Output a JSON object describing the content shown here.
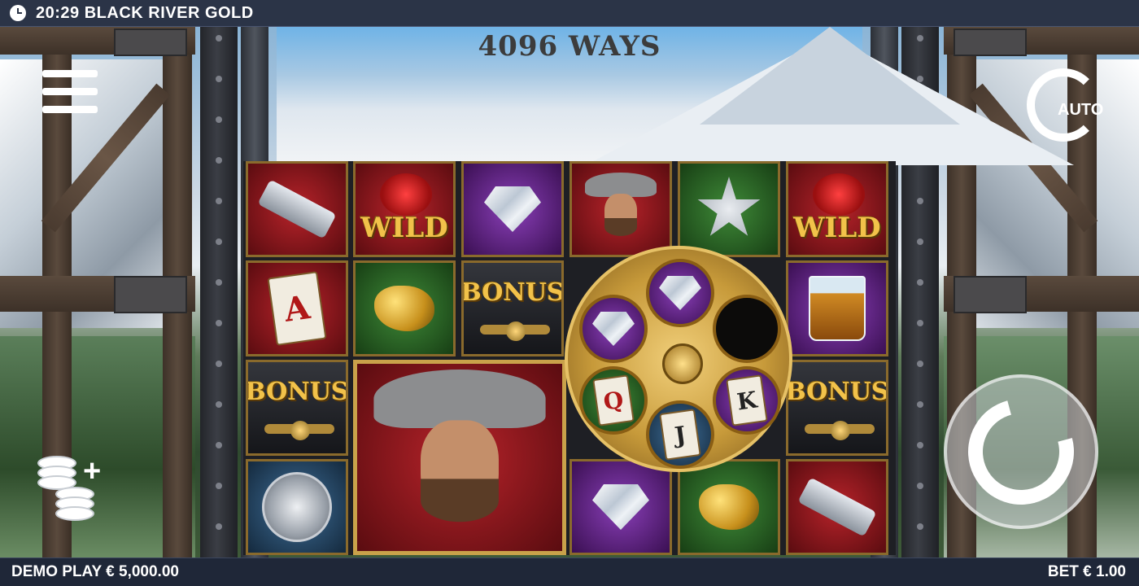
{
  "top_bar": {
    "time": "20:29",
    "title": "BLACK RIVER GOLD"
  },
  "banner": {
    "ways": "4096 WAYS"
  },
  "buttons": {
    "auto_label": "AUTO"
  },
  "reels": {
    "symbols": {
      "wild": "WILD",
      "bonus": "BONUS",
      "card_a": "A",
      "card_q": "Q",
      "card_j": "J",
      "card_k": "K",
      "sheriff": "SHERIFF"
    }
  },
  "bottom_bar": {
    "demo_label": "DEMO PLAY",
    "balance": "€ 5,000.00",
    "bet_label": "BET",
    "bet_value": "€ 1.00"
  }
}
